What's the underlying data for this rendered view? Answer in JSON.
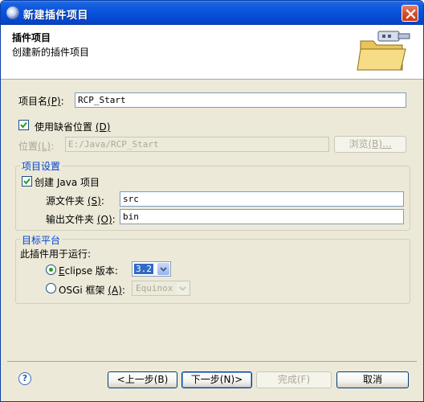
{
  "window": {
    "title": "新建插件项目"
  },
  "header": {
    "title": "插件项目",
    "subtitle": "创建新的插件项目"
  },
  "project_name": {
    "label": "项目名",
    "mnemonic": "(P)",
    "colon": ":",
    "value": "RCP_Start"
  },
  "use_default_location": {
    "label": "使用缺省位置",
    "mnemonic": "(D)",
    "checked": true
  },
  "location": {
    "label": "位置",
    "mnemonic": "(L)",
    "colon": ":",
    "value": "E:/Java/RCP_Start",
    "browse_label": "浏览",
    "browse_mnemonic": "(B)..."
  },
  "project_settings": {
    "group_title": "项目设置",
    "create_java": {
      "label_prefix": "创建 ",
      "label_mnemonic": "J",
      "label_suffix": "ava 项目",
      "checked": true
    },
    "source_folder": {
      "label": "源文件夹",
      "mnemonic": "(S)",
      "colon": ":",
      "value": "src"
    },
    "output_folder": {
      "label": "输出文件夹",
      "mnemonic": "(O)",
      "colon": ":",
      "value": "bin"
    }
  },
  "target_platform": {
    "group_title": "目标平台",
    "intro": "此插件用于运行:",
    "eclipse": {
      "label_mnemonic": "E",
      "label_rest": "clipse 版本",
      "colon": ":",
      "value": "3.2",
      "selected": true
    },
    "osgi": {
      "label": "OSGi 框架",
      "mnemonic": "(A)",
      "colon": ":",
      "value": "Equinox",
      "selected": false
    }
  },
  "footer": {
    "help_icon_text": "?",
    "back_label": "<上一步(B)",
    "next_label": "下一步(N)>",
    "finish_label": "完成(F)",
    "cancel_label": "取消"
  }
}
